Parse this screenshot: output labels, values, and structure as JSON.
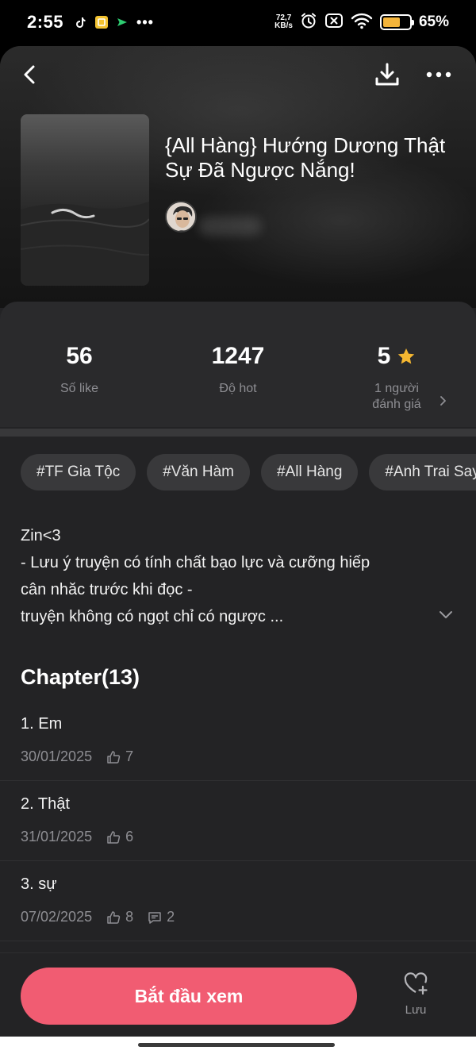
{
  "status_bar": {
    "time": "2:55",
    "network_speed_value": "72,7",
    "network_speed_unit": "KB/s",
    "battery_percent": "65%",
    "battery_level": 0.65,
    "apps": [
      "tiktok-icon",
      "note-icon",
      "messenger-icon"
    ],
    "more": "•••"
  },
  "story": {
    "title": "{All Hàng} Hướng Dương Thật Sự Đã Ngược Nắng!"
  },
  "stats": {
    "likes_value": "56",
    "likes_label": "Số like",
    "hot_value": "1247",
    "hot_label": "Độ hot",
    "rating_value": "5",
    "rating_label": "1 người đánh giá"
  },
  "tags": [
    "#TF Gia Tộc",
    "#Văn Hàm",
    "#All Hàng",
    "#Anh Trai Say"
  ],
  "description": {
    "lines": [
      "Zin<3",
      "- Lưu ý truyện có tính chất bạo lực và cưỡng hiếp",
      "cân nhăc trước khi đọc -",
      "truyện không có ngọt chỉ có ngược ..."
    ]
  },
  "chapters_heading": "Chapter(13)",
  "chapters": [
    {
      "title": "1. Em",
      "date": "30/01/2025",
      "likes": "7",
      "comments": ""
    },
    {
      "title": "2. Thật",
      "date": "31/01/2025",
      "likes": "6",
      "comments": ""
    },
    {
      "title": "3. sự",
      "date": "07/02/2025",
      "likes": "8",
      "comments": "2"
    }
  ],
  "bottom": {
    "start_label": "Bắt đầu xem",
    "save_label": "Lưu"
  },
  "colors": {
    "accent": "#f15c72",
    "star": "#f5b731",
    "background": "#232325"
  }
}
